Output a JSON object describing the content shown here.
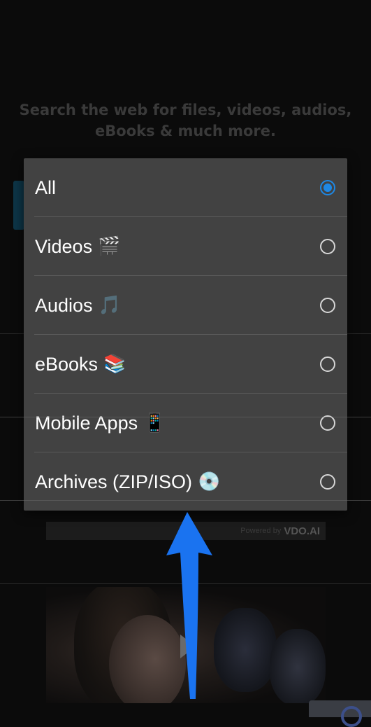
{
  "background": {
    "headline": "Search the web for files, videos, audios, eBooks & much more.",
    "powered_by_prefix": "Powered by",
    "powered_by_brand": "VDO.AI"
  },
  "dialog": {
    "options": [
      {
        "label": "All",
        "emoji": "",
        "selected": true
      },
      {
        "label": "Videos",
        "emoji": "🎬",
        "selected": false
      },
      {
        "label": "Audios",
        "emoji": "🎵",
        "selected": false
      },
      {
        "label": "eBooks",
        "emoji": "📚",
        "selected": false
      },
      {
        "label": "Mobile Apps",
        "emoji": "📱",
        "selected": false
      },
      {
        "label": "Archives (ZIP/ISO)",
        "emoji": "💿",
        "selected": false
      }
    ]
  },
  "colors": {
    "accent": "#1e88e5",
    "dialog_bg": "#424242",
    "annotation_arrow": "#1a73f0"
  },
  "icons": {
    "annotation": "up-arrow-icon",
    "video": "play-icon"
  }
}
